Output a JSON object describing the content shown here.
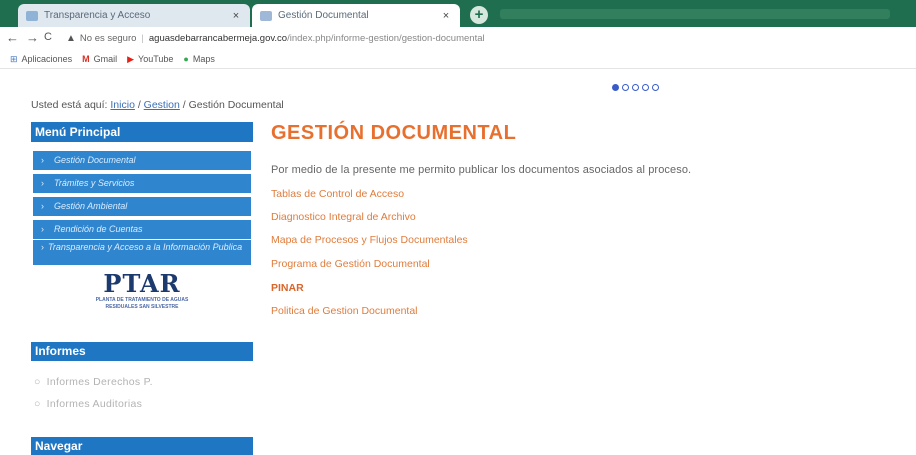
{
  "browser": {
    "tabs": [
      {
        "title": "Transparencia y Acceso",
        "close": "×"
      },
      {
        "title": "Gestión Documental",
        "close": "×"
      }
    ],
    "new_tab": "+",
    "nav": {
      "back": "←",
      "forward": "→",
      "reload": "C"
    },
    "address": {
      "security_label": "No es seguro",
      "host": "aguasdebarrancabermeja.gov.co",
      "path": "/index.php/informe-gestion/gestion-documental"
    },
    "bookmarks": [
      {
        "label": "Aplicaciones",
        "icon": "apps-grid-icon",
        "color": "#4a79c4"
      },
      {
        "label": "Gmail",
        "icon": "gmail-icon",
        "color": "#d93025"
      },
      {
        "label": "YouTube",
        "icon": "youtube-icon",
        "color": "#e62117"
      },
      {
        "label": "Maps",
        "icon": "maps-pin-icon",
        "color": "#34a853"
      }
    ]
  },
  "page": {
    "breadcrumb": {
      "prefix": "Usted está aquí:",
      "items": [
        "Inicio",
        "Gestion"
      ],
      "separator": "/",
      "current": "Gestión Documental"
    },
    "slider_dots": 5,
    "menu": {
      "header": "Menú Principal",
      "items": [
        "Gestión Documental",
        "Trámites y Servicios",
        "Gestión Ambiental",
        "Rendición de Cuentas",
        "Transparencia y Acceso a la Información Publica"
      ]
    },
    "logo": {
      "title": "PTAR",
      "subtitle_line1": "PLANTA DE TRATAMIENTO DE AGUAS",
      "subtitle_line2": "RESIDUALES SAN SILVESTRE"
    },
    "informes": {
      "header": "Informes",
      "items": [
        "Informes Derechos P.",
        "Informes Auditorias"
      ]
    },
    "navegar": {
      "header": "Navegar"
    },
    "main": {
      "title": "GESTIÓN DOCUMENTAL",
      "intro": "Por medio de la presente me permito publicar los documentos asociados al proceso.",
      "links": [
        "Tablas de Control de Acceso",
        "Diagnostico Integral de Archivo",
        "Mapa de Procesos y Flujos Documentales",
        "Programa de Gestión Documental",
        "PINAR",
        "Politica de Gestion Documental"
      ]
    },
    "colors": {
      "accent": "#e8702f",
      "menu_blue": "#1f76c2",
      "browser_frame": "#1f6e4f"
    }
  }
}
